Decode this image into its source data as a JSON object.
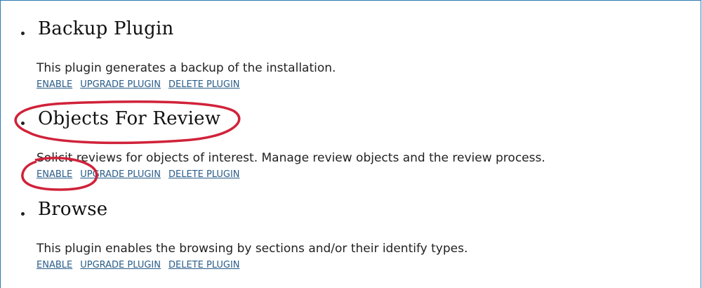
{
  "plugins": [
    {
      "title": "Backup Plugin",
      "description": "This plugin generates a backup of the installation.",
      "links": {
        "enable": "ENABLE",
        "upgrade": "UPGRADE PLUGIN",
        "delete": "DELETE PLUGIN"
      }
    },
    {
      "title": "Objects For Review",
      "description": "Solicit reviews for objects of interest. Manage review objects and the review process.",
      "links": {
        "enable": "ENABLE",
        "upgrade": "UPGRADE PLUGIN",
        "delete": "DELETE PLUGIN"
      }
    },
    {
      "title": "Browse",
      "description": "This plugin enables the browsing by sections and/or their identify types.",
      "links": {
        "enable": "ENABLE",
        "upgrade": "UPGRADE PLUGIN",
        "delete": "DELETE PLUGIN"
      }
    }
  ],
  "colors": {
    "annotation": "#d0223a",
    "link": "#2a5d8a",
    "border": "#2f7ab4"
  }
}
